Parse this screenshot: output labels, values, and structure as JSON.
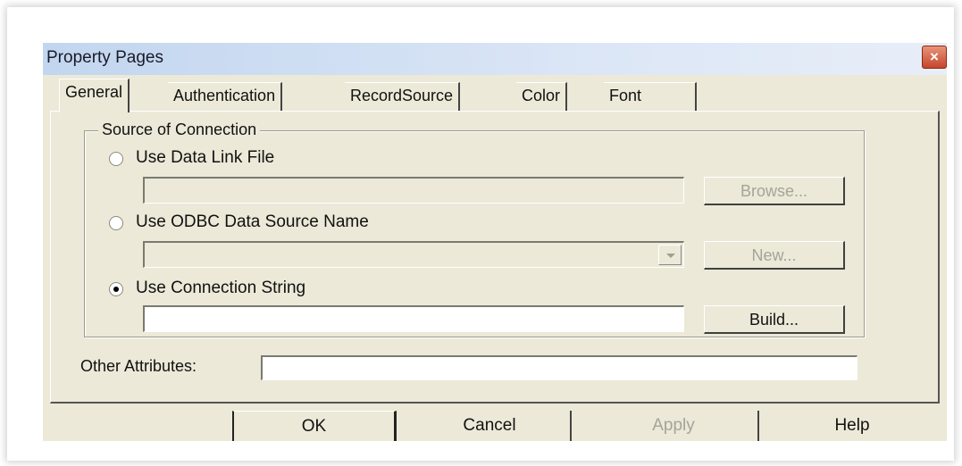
{
  "window": {
    "title": "Property Pages",
    "close_label": "×"
  },
  "tabs": [
    {
      "label": "General",
      "active": true
    },
    {
      "label": "Authentication",
      "active": false
    },
    {
      "label": "RecordSource",
      "active": false
    },
    {
      "label": "Color",
      "active": false
    },
    {
      "label": "Font",
      "active": false
    }
  ],
  "source_group": {
    "label": "Source of Connection",
    "options": [
      {
        "label": "Use Data Link File",
        "selected": false,
        "field_value": "",
        "button_label": "Browse...",
        "enabled": false
      },
      {
        "label": "Use ODBC Data Source Name",
        "selected": false,
        "field_value": "",
        "button_label": "New...",
        "enabled": false
      },
      {
        "label": "Use Connection String",
        "selected": true,
        "field_value": "",
        "button_label": "Build...",
        "enabled": true
      }
    ]
  },
  "other_attributes": {
    "label": "Other Attributes:",
    "value": ""
  },
  "buttons": {
    "ok": "OK",
    "cancel": "Cancel",
    "apply": "Apply",
    "help": "Help"
  }
}
